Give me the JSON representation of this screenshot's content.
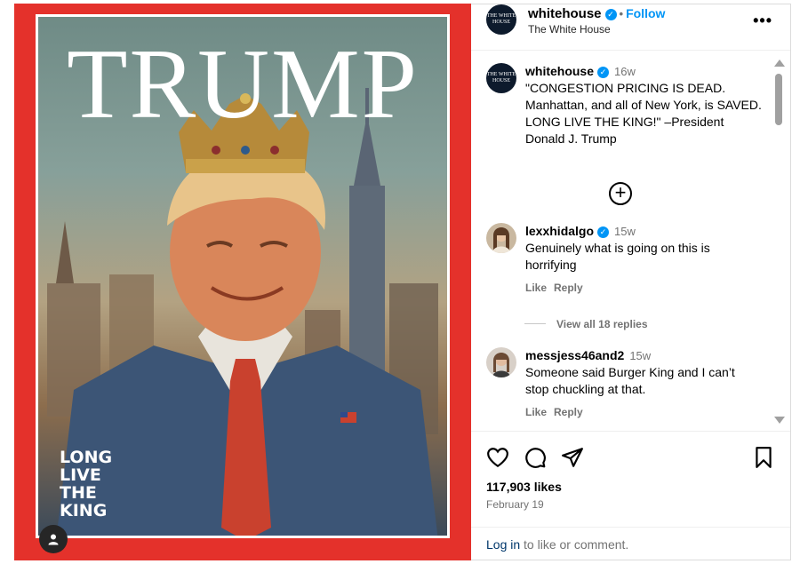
{
  "cover": {
    "title": "TRUMP",
    "tagline": "LONG LIVE THE KING",
    "frame_color": "#e4312b"
  },
  "header": {
    "avatar_text": "THE WHITE HOUSE",
    "username": "whitehouse",
    "separator": "•",
    "follow_label": "Follow",
    "subtitle": "The White House",
    "more_icon": "more-horizontal-icon"
  },
  "caption": {
    "username": "whitehouse",
    "time": "16w",
    "text": "\"CONGESTION PRICING IS DEAD. Manhattan, and all of New York, is SAVED. LONG LIVE THE KING!\" –President Donald J. Trump",
    "expand_icon": "plus-circle-icon"
  },
  "comments": [
    {
      "username": "lexxhidalgo",
      "verified": true,
      "time": "15w",
      "text": "Genuinely what is going on this is horrifying",
      "like_label": "Like",
      "reply_label": "Reply"
    },
    {
      "username": "messjess46and2",
      "verified": false,
      "time": "15w",
      "text": "Someone said Burger King and I can’t stop chuckling at that.",
      "like_label": "Like",
      "reply_label": "Reply"
    }
  ],
  "view_replies": "View all 18 replies",
  "actions": {
    "like_icon": "heart-icon",
    "comment_icon": "comment-icon",
    "share_icon": "send-icon",
    "save_icon": "bookmark-icon"
  },
  "likes": "117,903 likes",
  "date": "February 19",
  "login": {
    "link": "Log in",
    "rest": " to like or comment."
  },
  "colors": {
    "accent": "#0095f6",
    "muted": "#737373"
  }
}
